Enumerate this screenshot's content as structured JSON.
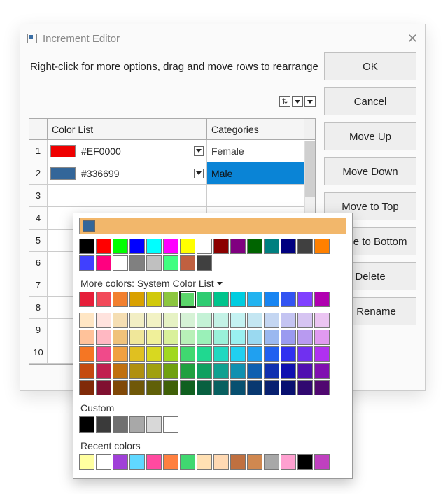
{
  "window": {
    "title": "Increment Editor"
  },
  "instructions": "Right-click for more options, drag and move rows to  rearrange",
  "buttons": {
    "ok": "OK",
    "cancel": "Cancel",
    "move_up": "Move Up",
    "move_down": "Move Down",
    "move_top": "Move to Top",
    "move_bottom": "Move to Bottom",
    "delete": "Delete",
    "rename": "Rename"
  },
  "columns": {
    "color_list": "Color List",
    "categories": "Categories"
  },
  "rows": [
    {
      "n": "1",
      "color": "#EF0000",
      "hex": "#EF0000",
      "category": "Female"
    },
    {
      "n": "2",
      "color": "#336699",
      "hex": "#336699",
      "category": "Male"
    },
    {
      "n": "3"
    },
    {
      "n": "4"
    },
    {
      "n": "5"
    },
    {
      "n": "6"
    },
    {
      "n": "7"
    },
    {
      "n": "8"
    },
    {
      "n": "9"
    },
    {
      "n": "10"
    }
  ],
  "picker": {
    "current_color": "#336699",
    "more_label": "More colors: System Color List",
    "custom_label": "Custom",
    "recent_label": "Recent colors",
    "selected_index": 9,
    "palette1": [
      "#000000",
      "#ff0000",
      "#00ff00",
      "#0000ff",
      "#00ffff",
      "#ff00ff",
      "#ffff00",
      "#ffffff",
      "#8b0000",
      "#800080",
      "#006400",
      "#008080",
      "#000080",
      "#404040",
      "#ff8000",
      "#4040ff",
      "#ff0080",
      "#ffffff",
      "#808080",
      "#c0c0c0",
      "#40ff80",
      "#c06040",
      "#404040"
    ],
    "palette2_row1": [
      "#e61f3a",
      "#f24a5a",
      "#f28030",
      "#d9a100",
      "#d1c90a",
      "#8cc63f",
      "#5bd66a",
      "#2ecc71",
      "#00c48c",
      "#00cde0",
      "#22b3f0",
      "#1885f2",
      "#3354f2",
      "#8040ff",
      "#b000b0"
    ],
    "system_grid": [
      [
        "#ffe6c4",
        "#ffe3de",
        "#f5deb3",
        "#f2eec4",
        "#f2f2c4",
        "#e6f2c4",
        "#d6f2d6",
        "#c4f2d6",
        "#c4f2e6",
        "#c4f2f2",
        "#c4e6f2",
        "#c4d6f2",
        "#c4c4f2",
        "#d6c4f2",
        "#ebc4f2"
      ],
      [
        "#ffc29a",
        "#ffb8c2",
        "#f0c27a",
        "#f0e79a",
        "#f0f09a",
        "#d9f09a",
        "#b8f0b8",
        "#9af0b8",
        "#9af0d9",
        "#9af0f0",
        "#9ad9f0",
        "#9ab8f0",
        "#9a9af0",
        "#b89af0",
        "#e09af0"
      ],
      [
        "#f57623",
        "#f04a8a",
        "#f0a040",
        "#e0c020",
        "#d8d820",
        "#a0d820",
        "#40d870",
        "#20d890",
        "#20d8c0",
        "#20d0f0",
        "#20a0f0",
        "#2060f0",
        "#3030f0",
        "#7030f0",
        "#b030f0"
      ],
      [
        "#c44a10",
        "#c02050",
        "#c07010",
        "#b09010",
        "#a0a010",
        "#70a010",
        "#20a040",
        "#10a060",
        "#10a090",
        "#1090b0",
        "#1060b0",
        "#1030b0",
        "#1010b0",
        "#5010b0",
        "#8010b0"
      ],
      [
        "#802a08",
        "#801030",
        "#804808",
        "#705808",
        "#606008",
        "#406008",
        "#106020",
        "#086040",
        "#086060",
        "#085070",
        "#083870",
        "#082070",
        "#081070",
        "#300870",
        "#500870"
      ]
    ],
    "custom": [
      "#000000",
      "#3a3a3a",
      "#707070",
      "#a8a8a8",
      "#d8d8d8",
      "#ffffff"
    ],
    "recent": [
      "#ffffa0",
      "#ffffff",
      "#a040d8",
      "#60d8ff",
      "#ff4aa0",
      "#ff8040",
      "#40d870",
      "#ffe0b3",
      "#ffd9b3",
      "#c07040",
      "#d08850",
      "#a8a8a8",
      "#ffa0d0",
      "#000000",
      "#c040c0"
    ]
  }
}
